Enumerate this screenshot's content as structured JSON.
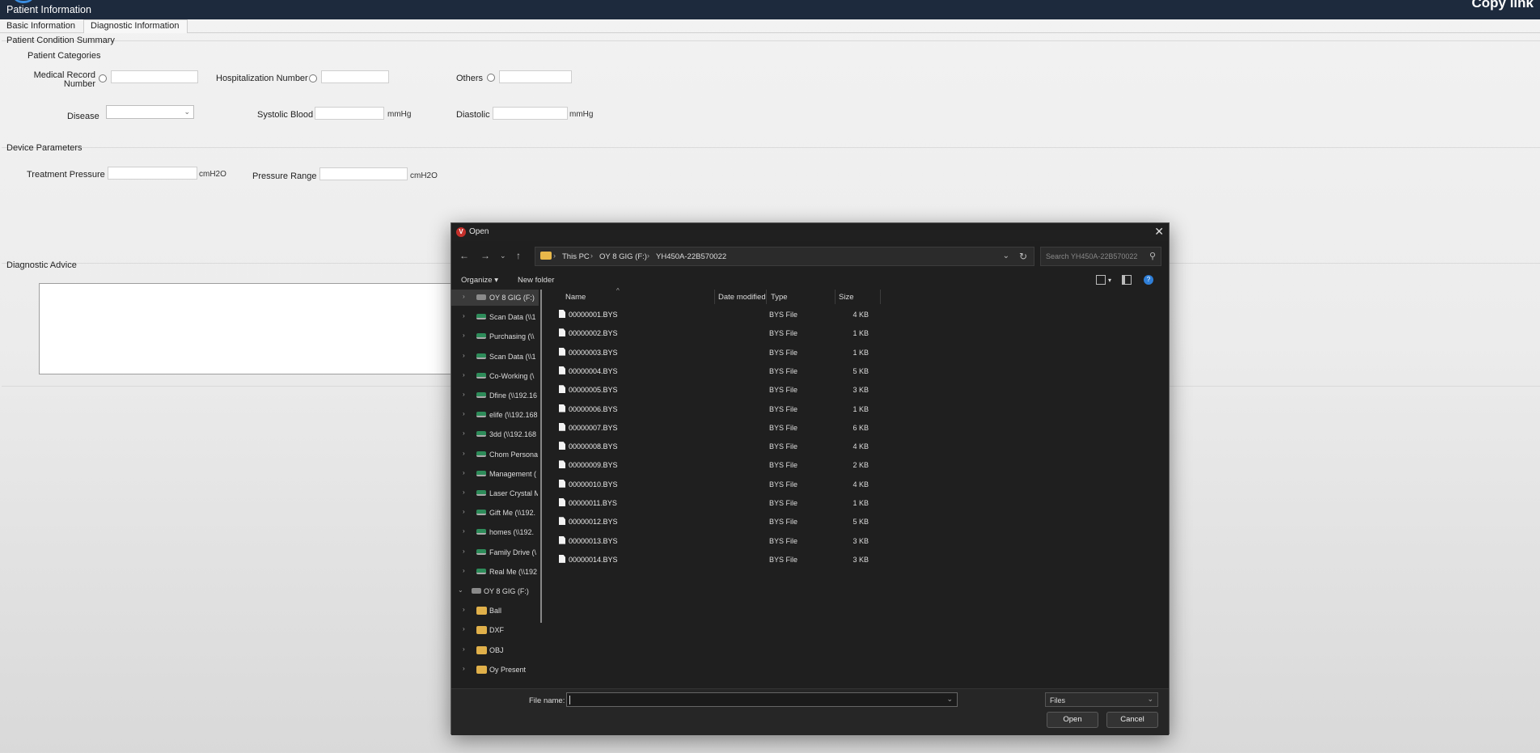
{
  "app": {
    "title": "Patient Information",
    "copy_link": "Copy link"
  },
  "tabs": [
    {
      "label": "Basic Information"
    },
    {
      "label": "Diagnostic Information"
    }
  ],
  "condition_summary": {
    "title": "Patient Condition Summary",
    "categories_label": "Patient Categories",
    "medical_record_label_1": "Medical Record",
    "medical_record_label_2": "Number",
    "hospitalization_label": "Hospitalization Number",
    "others_label": "Others",
    "disease_label": "Disease",
    "systolic_label": "Systolic Blood",
    "systolic_unit": "mmHg",
    "diastolic_label": "Diastolic",
    "diastolic_unit": "mmHg"
  },
  "device_parameters": {
    "title": "Device Parameters",
    "treatment_label": "Treatment Pressure",
    "treatment_unit": "cmH2O",
    "range_label": "Pressure Range",
    "range_unit": "cmH2O"
  },
  "diagnostic_advice": {
    "title": "Diagnostic Advice"
  },
  "dialog": {
    "title": "Open",
    "app_icon_letter": "V",
    "breadcrumb": [
      "This PC",
      "OY 8 GIG (F:)",
      "YH450A-22B570022"
    ],
    "search_placeholder": "Search YH450A-22B570022",
    "toolbar": {
      "organize": "Organize",
      "new_folder": "New folder"
    },
    "nav_items": [
      {
        "label": "OY 8 GIG (F:)",
        "kind": "usb-sub",
        "selected": true
      },
      {
        "label": "Scan Data (\\\\1",
        "kind": "drive"
      },
      {
        "label": "Purchasing (\\\\",
        "kind": "drive"
      },
      {
        "label": "Scan Data (\\\\1",
        "kind": "drive"
      },
      {
        "label": "Co-Working (\\",
        "kind": "drive"
      },
      {
        "label": "Dfine (\\\\192.16",
        "kind": "drive"
      },
      {
        "label": "elife (\\\\192.168",
        "kind": "drive"
      },
      {
        "label": "3dd (\\\\192.168",
        "kind": "drive"
      },
      {
        "label": "Chom Persona",
        "kind": "drive"
      },
      {
        "label": "Management (",
        "kind": "drive"
      },
      {
        "label": "Laser Crystal M",
        "kind": "drive"
      },
      {
        "label": "Gift Me (\\\\192.",
        "kind": "drive"
      },
      {
        "label": "homes (\\\\192.",
        "kind": "drive"
      },
      {
        "label": "Family Drive (\\",
        "kind": "drive"
      },
      {
        "label": "Real Me (\\\\192",
        "kind": "drive"
      },
      {
        "label": "OY 8 GIG (F:)",
        "kind": "usb"
      },
      {
        "label": "Ball",
        "kind": "folder"
      },
      {
        "label": "DXF",
        "kind": "folder"
      },
      {
        "label": "OBJ",
        "kind": "folder"
      },
      {
        "label": "Oy Present",
        "kind": "folder"
      }
    ],
    "columns": {
      "name": "Name",
      "date": "Date modified",
      "type": "Type",
      "size": "Size"
    },
    "files": [
      {
        "name": "00000001.BYS",
        "type": "BYS File",
        "size": "4 KB"
      },
      {
        "name": "00000002.BYS",
        "type": "BYS File",
        "size": "1 KB"
      },
      {
        "name": "00000003.BYS",
        "type": "BYS File",
        "size": "1 KB"
      },
      {
        "name": "00000004.BYS",
        "type": "BYS File",
        "size": "5 KB"
      },
      {
        "name": "00000005.BYS",
        "type": "BYS File",
        "size": "3 KB"
      },
      {
        "name": "00000006.BYS",
        "type": "BYS File",
        "size": "1 KB"
      },
      {
        "name": "00000007.BYS",
        "type": "BYS File",
        "size": "6 KB"
      },
      {
        "name": "00000008.BYS",
        "type": "BYS File",
        "size": "4 KB"
      },
      {
        "name": "00000009.BYS",
        "type": "BYS File",
        "size": "2 KB"
      },
      {
        "name": "00000010.BYS",
        "type": "BYS File",
        "size": "4 KB"
      },
      {
        "name": "00000011.BYS",
        "type": "BYS File",
        "size": "1 KB"
      },
      {
        "name": "00000012.BYS",
        "type": "BYS File",
        "size": "5 KB"
      },
      {
        "name": "00000013.BYS",
        "type": "BYS File",
        "size": "3 KB"
      },
      {
        "name": "00000014.BYS",
        "type": "BYS File",
        "size": "3 KB"
      }
    ],
    "footer": {
      "file_name_label": "File name:",
      "file_name_value": "",
      "filter_value": "Files",
      "open_label": "Open",
      "cancel_label": "Cancel"
    }
  }
}
